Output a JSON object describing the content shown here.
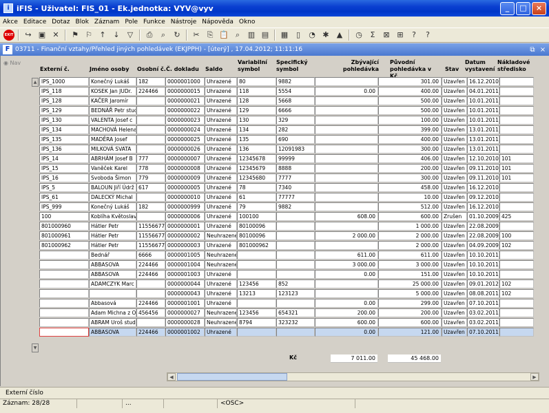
{
  "window": {
    "title": "iFIS - Uživatel: FIS_01 - Ek.jednotka: VYV@vyv"
  },
  "menu": [
    "Akce",
    "Editace",
    "Dotaz",
    "Blok",
    "Záznam",
    "Pole",
    "Funkce",
    "Nástroje",
    "Nápověda",
    "Okno"
  ],
  "toolbar": {
    "exit_label": "EXIT"
  },
  "document": {
    "title": "03711 - Finanční vztahy/Přehled jiných pohledávek (EKJPPH) - [úterý] , 17.04.2012; 11:11:16"
  },
  "nav": {
    "label": "Nav"
  },
  "columns": [
    {
      "label": "Externí č."
    },
    {
      "label": "Jméno osoby"
    },
    {
      "label": "Osobní č."
    },
    {
      "label": "Č. dokladu"
    },
    {
      "label": "Saldo"
    },
    {
      "label": "Variabilní symbol"
    },
    {
      "label": "Specifický symbol"
    },
    {
      "label": "Zbývající pohledávka"
    },
    {
      "label": "Původní pohledávka v Kč"
    },
    {
      "label": "Stav"
    },
    {
      "label": "Datum vystavení"
    },
    {
      "label": "Nákladové středisko"
    }
  ],
  "rows": [
    [
      "IPS_1000",
      "Konečný Lukáš",
      "182",
      "0000001000",
      "Uhrazené",
      "80",
      "9882",
      "",
      "301.00",
      "Uzavřen",
      "16.12.2010",
      ""
    ],
    [
      "IPS_118",
      "KOSEK Jan JUDr.",
      "224466",
      "0000000015",
      "Uhrazené",
      "118",
      "5554",
      "0.00",
      "400.00",
      "Uzavřen",
      "04.01.2011",
      ""
    ],
    [
      "IPS_128",
      "KAČER Jaromír",
      "",
      "0000000021",
      "Uhrazené",
      "128",
      "5668",
      "",
      "500.00",
      "Uzavřen",
      "10.01.2011",
      ""
    ],
    [
      "IPS_129",
      "BEDNÁŘ Petr stud",
      "",
      "0000000022",
      "Uhrazené",
      "129",
      "6666",
      "",
      "500.00",
      "Uzavřen",
      "10.01.2011",
      ""
    ],
    [
      "IPS_130",
      "VALENTA Josef c",
      "",
      "0000000023",
      "Uhrazené",
      "130",
      "329",
      "",
      "100.00",
      "Uzavřen",
      "10.01.2011",
      ""
    ],
    [
      "IPS_134",
      "MACHOVÁ Helena",
      "",
      "0000000024",
      "Uhrazené",
      "134",
      "282",
      "",
      "399.00",
      "Uzavřen",
      "13.01.2011",
      ""
    ],
    [
      "IPS_135",
      "MADĚRA Josef",
      "",
      "0000000025",
      "Uhrazené",
      "135",
      "690",
      "",
      "400.00",
      "Uzavřen",
      "13.01.2011",
      ""
    ],
    [
      "IPS_136",
      "MILKOVÁ SVATA",
      "",
      "0000000026",
      "Uhrazené",
      "136",
      "12091983",
      "",
      "300.00",
      "Uzavřen",
      "13.01.2011",
      ""
    ],
    [
      "IPS_14",
      "ABRHÁM Josef B",
      "777",
      "0000000007",
      "Uhrazené",
      "12345678",
      "99999",
      "",
      "406.00",
      "Uzavřen",
      "12.10.2010",
      "101"
    ],
    [
      "IPS_15",
      "Vaněček Karel",
      "778",
      "0000000008",
      "Uhrazené",
      "12345679",
      "8888",
      "",
      "200.00",
      "Uzavřen",
      "09.11.2010",
      "101"
    ],
    [
      "IPS_16",
      "Svoboda Šimon",
      "779",
      "0000000009",
      "Uhrazené",
      "12345680",
      "7777",
      "",
      "300.00",
      "Uzavřen",
      "09.11.2010",
      "101"
    ],
    [
      "IPS_5",
      "BALOUN Jiří Údrž",
      "617",
      "0000000005",
      "Uhrazené",
      "78",
      "7340",
      "",
      "458.00",
      "Uzavřen",
      "16.12.2010",
      ""
    ],
    [
      "IPS_61",
      "DALECKÝ Michal",
      "",
      "0000000010",
      "Uhrazené",
      "61",
      "77777",
      "",
      "10.00",
      "Uzavřen",
      "09.12.2010",
      ""
    ],
    [
      "IPS_999",
      "Konečný Lukáš",
      "182",
      "0000000999",
      "Uhrazené",
      "79",
      "9882",
      "",
      "512.00",
      "Uzavřen",
      "16.12.2010",
      ""
    ],
    [
      "100",
      "Koblíha Květoslav",
      "",
      "0000000006",
      "Uhrazené",
      "100100",
      "",
      "608.00",
      "600.00",
      "Zrušen",
      "01.10.2009",
      "425"
    ],
    [
      "801000960",
      "Hátler Petr",
      "11556677",
      "0000000001",
      "Uhrazené",
      "80100096",
      "",
      "",
      "1 000.00",
      "Uzavřen",
      "22.08.2009",
      ""
    ],
    [
      "801000961",
      "Hátler Petr",
      "11556677",
      "0000000002",
      "Neuhrazené",
      "80100096",
      "",
      "2 000.00",
      "2 000.00",
      "Uzavřen",
      "22.08.2009",
      "100"
    ],
    [
      "801000962",
      "Hátler Petr",
      "11556677",
      "0000000003",
      "Uhrazené",
      "801000962",
      "",
      "",
      "2 000.00",
      "Uzavřen",
      "04.09.2009",
      "102"
    ],
    [
      "",
      "Bednář",
      "6666",
      "0000001005",
      "Neuhrazené",
      "",
      "",
      "611.00",
      "611.00",
      "Uzavřen",
      "10.10.2011",
      ""
    ],
    [
      "",
      "ABBASOVA",
      "224466",
      "0000001004",
      "Neuhrazené",
      "",
      "",
      "3 000.00",
      "3 000.00",
      "Uzavřen",
      "10.10.2011",
      ""
    ],
    [
      "",
      "ABBASOVA",
      "224466",
      "0000001003",
      "Uhrazené",
      "",
      "",
      "0.00",
      "151.00",
      "Uzavřen",
      "10.10.2011",
      ""
    ],
    [
      "",
      "ADAMCZYK Marc",
      "",
      "0000000044",
      "Uhrazené",
      "123456",
      "852",
      "",
      "25 000.00",
      "Uzavřen",
      "09.01.2012",
      "102"
    ],
    [
      "",
      "",
      "",
      "0000000043",
      "Uhrazené",
      "13213",
      "123123",
      "",
      "5 000.00",
      "Uzavřen",
      "08.08.2011",
      "102"
    ],
    [
      "",
      "Abbasová",
      "224466",
      "0000001001",
      "Uhrazené",
      "",
      "",
      "0.00",
      "299.00",
      "Uzavřen",
      "07.10.2011",
      ""
    ],
    [
      "",
      "Adam Michna z O",
      "456456",
      "0000000027",
      "Neuhrazené",
      "123456",
      "654321",
      "200.00",
      "200.00",
      "Uzavřen",
      "03.02.2011",
      ""
    ],
    [
      "",
      "ABRAM Uroš stud",
      "",
      "0000000028",
      "Neuhrazené",
      "8794",
      "323232",
      "600.00",
      "600.00",
      "Uzavřen",
      "03.02.2011",
      ""
    ],
    [
      "",
      "ABBASOVA",
      "224466",
      "0000001002",
      "Uhrazené",
      "",
      "",
      "0.00",
      "121.00",
      "Uzavřen",
      "07.10.2011",
      ""
    ]
  ],
  "totals": {
    "label": "Kč",
    "remaining": "7 011.00",
    "original": "45 468.00"
  },
  "status": {
    "hint": "Externí číslo",
    "record": "Záznam: 28/28",
    "segment2": "",
    "segment3": "...",
    "segment4": "",
    "segment5": "<OSC>"
  }
}
